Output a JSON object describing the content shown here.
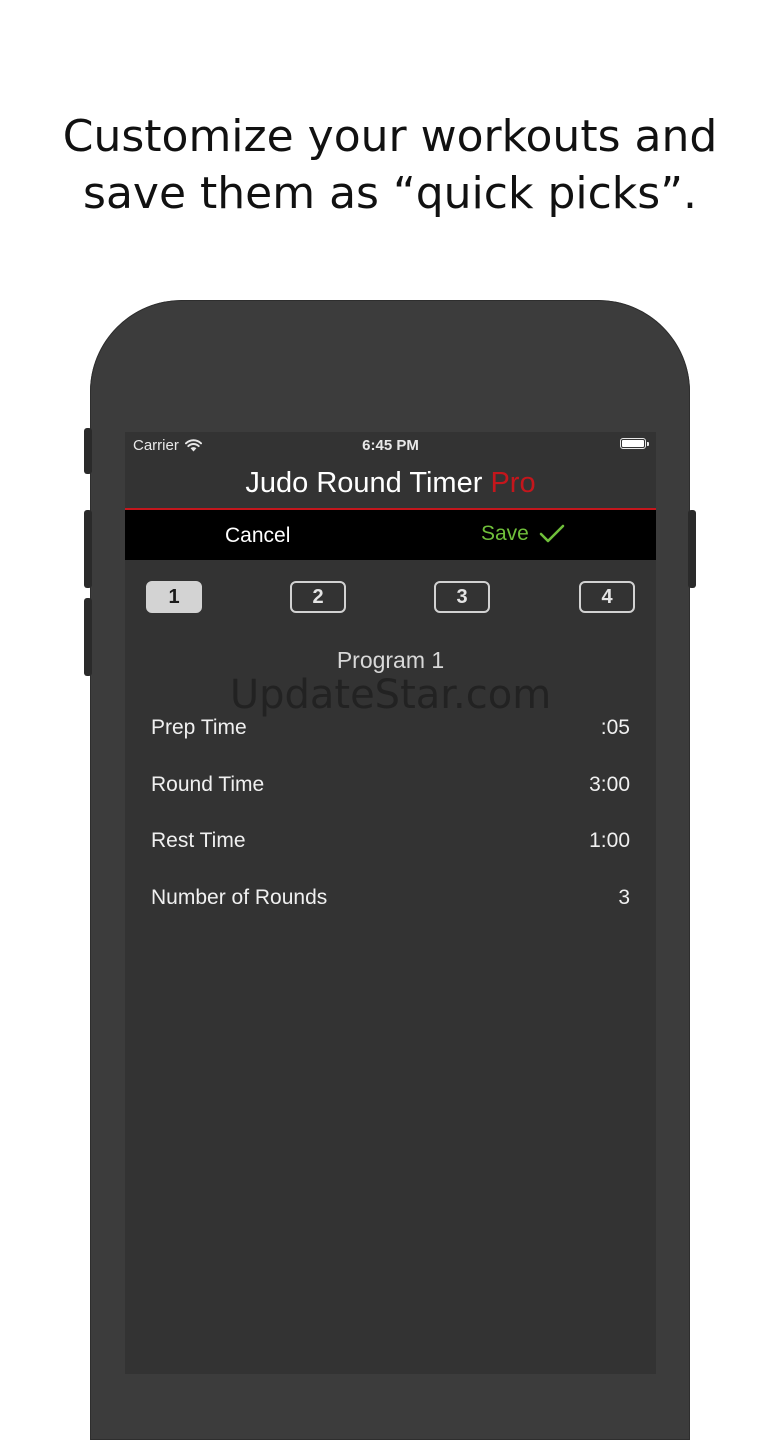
{
  "headline": {
    "line1": "Customize your workouts and",
    "line2": "save them as “quick picks”."
  },
  "status_bar": {
    "carrier": "Carrier",
    "time": "6:45 PM",
    "wifi_icon": "wifi-icon",
    "battery_icon": "battery-icon"
  },
  "app_title": {
    "main": "Judo Round Timer",
    "accent": "Pro",
    "accent_color": "#c4161c"
  },
  "nav": {
    "cancel_label": "Cancel",
    "save_label": "Save",
    "save_color": "#6fbf3a",
    "save_icon": "checkmark-icon"
  },
  "quick_picks": [
    {
      "label": "1",
      "selected": true
    },
    {
      "label": "2",
      "selected": false
    },
    {
      "label": "3",
      "selected": false
    },
    {
      "label": "4",
      "selected": false
    }
  ],
  "program": {
    "title": "Program 1",
    "settings": [
      {
        "label": "Prep Time",
        "value": ":05"
      },
      {
        "label": "Round Time",
        "value": "3:00"
      },
      {
        "label": "Rest Time",
        "value": "1:00"
      },
      {
        "label": "Number of Rounds",
        "value": "3"
      }
    ]
  },
  "watermark": "UpdateStar.com"
}
